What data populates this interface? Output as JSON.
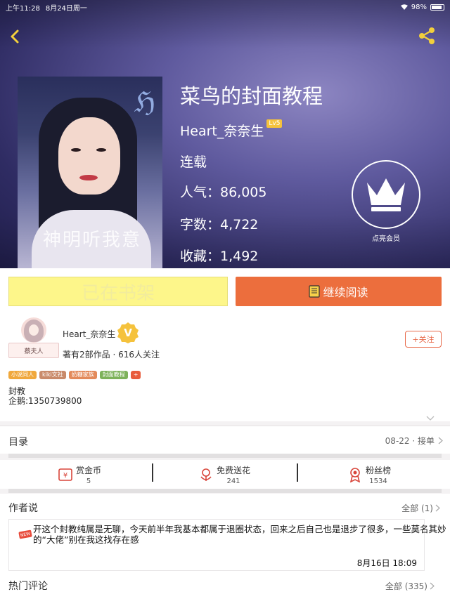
{
  "status_bar": {
    "time": "上午11:28",
    "date": "8月24日周一",
    "battery": "98%"
  },
  "book": {
    "title": "菜鸟的封面教程",
    "author": "Heart_奈奈生",
    "author_level": "Lv5",
    "status": "连载",
    "popularity": "人气：86,005",
    "word_count": "字数：4,722",
    "favorites": "收藏：1,492",
    "cover_title_text": "神明听我意",
    "vip_label": "点亮会员"
  },
  "actions": {
    "shelf_label": "已在书架",
    "read_label": "继续阅读"
  },
  "author_card": {
    "name": "Heart_奈奈生",
    "v_mark": "V",
    "frame_label": "蔡夫人",
    "meta": "著有2部作品 · 616人关注",
    "follow_label": "+关注",
    "tags": [
      {
        "label": "小说同人",
        "color": "#f0a83c"
      },
      {
        "label": "kiki文社",
        "color": "#c98a6a"
      },
      {
        "label": "奶糖家族",
        "color": "#e38a5a"
      },
      {
        "label": "封面教程",
        "color": "#7db25a"
      },
      {
        "label": "+",
        "color": "#e85a3a"
      }
    ],
    "intro_line1": "封教",
    "intro_line2": "企鹅:1350739800"
  },
  "catalog": {
    "label": "目录",
    "update": "08-22 · 接单"
  },
  "gifts": [
    {
      "name": "赏金币",
      "value": "5",
      "icon": "coin-icon"
    },
    {
      "name": "免费送花",
      "value": "241",
      "icon": "flower-icon"
    },
    {
      "name": "粉丝榜",
      "value": "1534",
      "icon": "ribbon-icon"
    }
  ],
  "author_says": {
    "label": "作者说",
    "all_label": "全部 (1)",
    "new_badge": "NEW",
    "text": "开这个封教纯属是无聊，今天前半年我基本都属于退圈状态，回来之后自己也是退步了很多，一些莫名其妙的“大佬”别在我这找存在感",
    "date": "8月16日  18:09"
  },
  "hot_comments": {
    "label": "热门评论",
    "all_label": "全部 (335)"
  },
  "colors": {
    "accent_orange": "#ec6e3d",
    "shelf_yellow": "#fdf68a",
    "level_gold": "#f5c23c"
  }
}
